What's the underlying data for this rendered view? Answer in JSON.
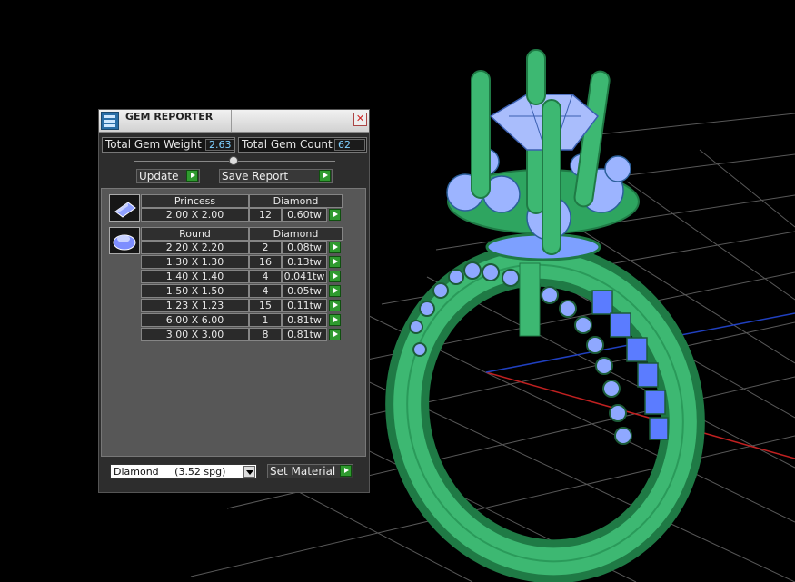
{
  "window": {
    "title": "GEM REPORTER",
    "close_glyph": "✕",
    "icon": "gem-reporter-icon"
  },
  "stats": {
    "total_weight_label": "Total Gem Weight",
    "total_weight_value": "2.63",
    "total_count_label": "Total Gem Count",
    "total_count_value": "62"
  },
  "toolbar": {
    "update_label": "Update",
    "save_report_label": "Save Report"
  },
  "groups": [
    {
      "shape_icon": "princess-gem-icon",
      "shape": "Princess",
      "material": "Diamond",
      "rows": [
        {
          "size": "2.00 X 2.00",
          "count": "12",
          "weight": "0.60tw"
        }
      ]
    },
    {
      "shape_icon": "round-gem-icon",
      "shape": "Round",
      "material": "Diamond",
      "rows": [
        {
          "size": "2.20 X 2.20",
          "count": "2",
          "weight": "0.08tw"
        },
        {
          "size": "1.30 X 1.30",
          "count": "16",
          "weight": "0.13tw"
        },
        {
          "size": "1.40 X 1.40",
          "count": "4",
          "weight": "0.041tw"
        },
        {
          "size": "1.50 X 1.50",
          "count": "4",
          "weight": "0.05tw"
        },
        {
          "size": "1.23 X 1.23",
          "count": "15",
          "weight": "0.11tw"
        },
        {
          "size": "6.00 X 6.00",
          "count": "1",
          "weight": "0.81tw"
        },
        {
          "size": "3.00 X 3.00",
          "count": "8",
          "weight": "0.81tw"
        }
      ]
    }
  ],
  "material_select": {
    "value": "Diamond     (3.52 spg)"
  },
  "set_material_label": "Set Material",
  "colors": {
    "ring_green": "#2f9e5f",
    "gem_blue": "#8fa8ff",
    "grid_line": "#5a5a5a",
    "axis_red": "#c02020",
    "axis_blue": "#2040c0",
    "value_text": "#7fd0ff"
  }
}
